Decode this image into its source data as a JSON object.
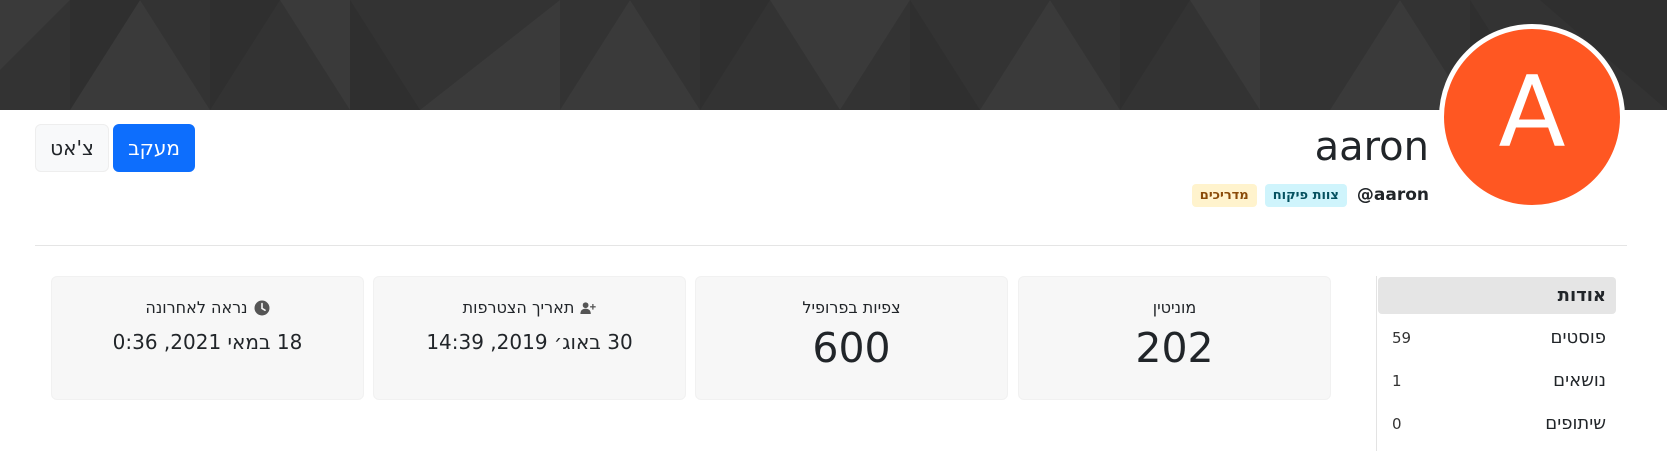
{
  "profile": {
    "avatar_letter": "A",
    "fullname": "aaron",
    "username": "@aaron",
    "groups": [
      "צוות פיקוח",
      "מדריכים"
    ]
  },
  "actions": {
    "follow_label": "מעקב",
    "chat_label": "צ'אט"
  },
  "sidebar": {
    "items": [
      {
        "label": "אודות",
        "count": ""
      },
      {
        "label": "פוסטים",
        "count": "59"
      },
      {
        "label": "נושאים",
        "count": "1"
      },
      {
        "label": "שיתופים",
        "count": "0"
      }
    ]
  },
  "stats": {
    "reputation": {
      "label": "מוניטין",
      "value": "202"
    },
    "profile_views": {
      "label": "צפיות בפרופיל",
      "value": "600"
    },
    "joined": {
      "label": "תאריך הצטרפות",
      "value": "30 באוג׳ 2019, 14:39",
      "icon": "user-plus-icon"
    },
    "last_seen": {
      "label": "נראה לאחרונה",
      "value": "18 במאי 2021, 0:36",
      "icon": "clock-icon"
    }
  },
  "colors": {
    "cover": "#333333",
    "avatar_bg": "#ff5722",
    "follow_button": "#0d6efd",
    "badge_group1_bg": "#cff4fc",
    "badge_group2_bg": "#fff3cd"
  }
}
